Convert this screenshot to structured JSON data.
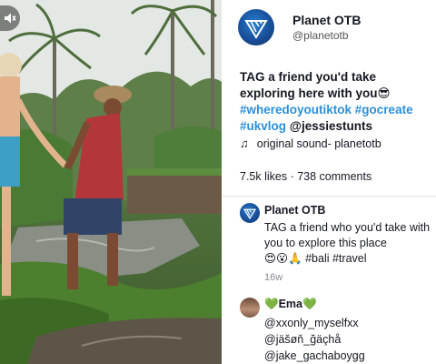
{
  "account": {
    "display_name": "Planet OTB",
    "handle": "@planetotb",
    "avatar_icon": "planet-otb-logo-icon"
  },
  "post": {
    "caption_text": "TAG a friend you'd take exploring here with you",
    "caption_emoji": "😎",
    "hashtags": [
      "#wheredoyoutiktok",
      "#gocreate",
      "#ukvlog"
    ],
    "mention": "@jessiestunts",
    "sound_icon": "music-note-icon",
    "sound": "original sound- planetotb",
    "stats": "7.5k likes · 738 comments"
  },
  "video": {
    "mute_icon": "speaker-muted-icon"
  },
  "comments": [
    {
      "author": "Planet OTB",
      "text": "TAG a friend who you'd take with you to explore this place",
      "emoji_line": "😍😮🙏 #bali #travel",
      "time": "16w"
    },
    {
      "author": "Ema",
      "name_decoration": "💚",
      "lines": [
        "@xxonly_myselfxx",
        "@jäšøň_ğäçhå",
        "@jake_gachaboygg",
        "@..."
      ]
    }
  ],
  "colors": {
    "hashtag": "#2b8fd8",
    "text": "#161823",
    "muted": "#8a8b91",
    "emoji_heart": "#36c23a"
  }
}
